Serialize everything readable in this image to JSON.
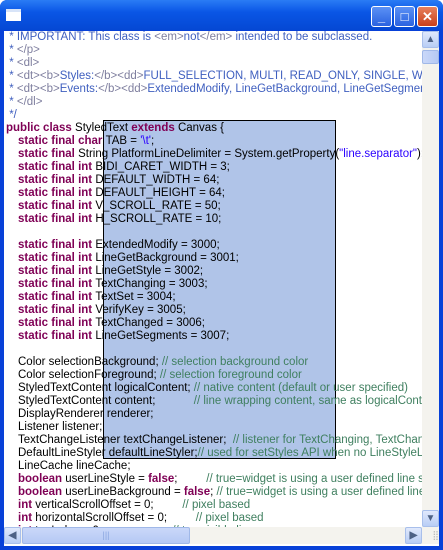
{
  "window": {
    "icon": "window-icon",
    "minimize": "_",
    "maximize": "□",
    "close": "✕"
  },
  "colors": {
    "keyword": "#7f0055",
    "comment": "#3f7f5f",
    "javadoc": "#3f5fbf",
    "string": "#2a00ff",
    "overlay": "#b0c4e8"
  },
  "scrollbars": {
    "up": "▲",
    "down": "▼",
    "left": "◀",
    "right": "▶",
    "grip": "⣿"
  },
  "lines": [
    {
      "i": 0,
      "s": [
        [
          "jd",
          " * IMPORTANT: This class is "
        ],
        [
          "tg",
          "<em>"
        ],
        [
          "jd",
          "not"
        ],
        [
          "tg",
          "</em>"
        ],
        [
          "jd",
          " intended to be subclassed."
        ]
      ]
    },
    {
      "i": 0,
      "s": [
        [
          "jd",
          " * "
        ],
        [
          "tg",
          "</p>"
        ]
      ]
    },
    {
      "i": 0,
      "s": [
        [
          "jd",
          " * "
        ],
        [
          "tg",
          "<dl>"
        ]
      ]
    },
    {
      "i": 0,
      "s": [
        [
          "jd",
          " * "
        ],
        [
          "tg",
          "<dt><b>"
        ],
        [
          "jd",
          "Styles:"
        ],
        [
          "tg",
          "</b><dd>"
        ],
        [
          "jd",
          "FULL_SELECTION, MULTI, READ_ONLY, SINGLE, WRAP"
        ]
      ]
    },
    {
      "i": 0,
      "s": [
        [
          "jd",
          " * "
        ],
        [
          "tg",
          "<dt><b>"
        ],
        [
          "jd",
          "Events:"
        ],
        [
          "tg",
          "</b><dd>"
        ],
        [
          "jd",
          "ExtendedModify, LineGetBackground, LineGetSegments"
        ]
      ]
    },
    {
      "i": 0,
      "s": [
        [
          "jd",
          " * "
        ],
        [
          "tg",
          "</dl>"
        ]
      ]
    },
    {
      "i": 0,
      "s": [
        [
          "jd",
          " */"
        ]
      ]
    },
    {
      "i": 0,
      "s": [
        [
          "kw",
          "public class "
        ],
        [
          "pl",
          "StyledText "
        ],
        [
          "kw",
          "extends "
        ],
        [
          "pl",
          "Canvas {"
        ]
      ]
    },
    {
      "i": 1,
      "s": [
        [
          "kw",
          "static final char "
        ],
        [
          "pl",
          "TAB = "
        ],
        [
          "st",
          "'\\t'"
        ],
        [
          "pl",
          ";"
        ]
      ]
    },
    {
      "i": 1,
      "s": [
        [
          "kw",
          "static final "
        ],
        [
          "pl",
          "String PlatformLineDelimiter = System.getProperty("
        ],
        [
          "st",
          "\"line.separator\""
        ],
        [
          "pl",
          ");"
        ]
      ]
    },
    {
      "i": 1,
      "s": [
        [
          "kw",
          "static final int "
        ],
        [
          "pl",
          "BIDI_CARET_WIDTH = 3;"
        ]
      ]
    },
    {
      "i": 1,
      "s": [
        [
          "kw",
          "static final int "
        ],
        [
          "pl",
          "DEFAULT_WIDTH = 64;"
        ]
      ]
    },
    {
      "i": 1,
      "s": [
        [
          "kw",
          "static final int "
        ],
        [
          "pl",
          "DEFAULT_HEIGHT = 64;"
        ]
      ]
    },
    {
      "i": 1,
      "s": [
        [
          "kw",
          "static final int "
        ],
        [
          "pl",
          "V_SCROLL_RATE = 50;"
        ]
      ]
    },
    {
      "i": 1,
      "s": [
        [
          "kw",
          "static final int "
        ],
        [
          "pl",
          "H_SCROLL_RATE = 10;"
        ]
      ]
    },
    {
      "i": 1,
      "s": []
    },
    {
      "i": 1,
      "s": [
        [
          "kw",
          "static final int "
        ],
        [
          "pl",
          "ExtendedModify = 3000;"
        ]
      ]
    },
    {
      "i": 1,
      "s": [
        [
          "kw",
          "static final int "
        ],
        [
          "pl",
          "LineGetBackground = 3001;"
        ]
      ]
    },
    {
      "i": 1,
      "s": [
        [
          "kw",
          "static final int "
        ],
        [
          "pl",
          "LineGetStyle = 3002;"
        ]
      ]
    },
    {
      "i": 1,
      "s": [
        [
          "kw",
          "static final int "
        ],
        [
          "pl",
          "TextChanging = 3003;"
        ]
      ]
    },
    {
      "i": 1,
      "s": [
        [
          "kw",
          "static final int "
        ],
        [
          "pl",
          "TextSet = 3004;"
        ]
      ]
    },
    {
      "i": 1,
      "s": [
        [
          "kw",
          "static final int "
        ],
        [
          "pl",
          "VerifyKey = 3005;"
        ]
      ]
    },
    {
      "i": 1,
      "s": [
        [
          "kw",
          "static final int "
        ],
        [
          "pl",
          "TextChanged = 3006;"
        ]
      ]
    },
    {
      "i": 1,
      "s": [
        [
          "kw",
          "static final int "
        ],
        [
          "pl",
          "LineGetSegments = 3007;"
        ]
      ]
    },
    {
      "i": 1,
      "s": []
    },
    {
      "i": 1,
      "s": [
        [
          "pl",
          "Color selectionBackground; "
        ],
        [
          "cm",
          "// selection background color"
        ]
      ]
    },
    {
      "i": 1,
      "s": [
        [
          "pl",
          "Color selectionForeground; "
        ],
        [
          "cm",
          "// selection foreground color"
        ]
      ]
    },
    {
      "i": 1,
      "s": [
        [
          "pl",
          "StyledTextContent logicalContent; "
        ],
        [
          "cm",
          "// native content (default or user specified)"
        ]
      ]
    },
    {
      "i": 1,
      "s": [
        [
          "pl",
          "StyledTextContent content;            "
        ],
        [
          "cm",
          "// line wrapping content, same as logicalContent if no wrapping"
        ]
      ]
    },
    {
      "i": 1,
      "s": [
        [
          "pl",
          "DisplayRenderer renderer;"
        ]
      ]
    },
    {
      "i": 1,
      "s": [
        [
          "pl",
          "Listener listener;"
        ]
      ]
    },
    {
      "i": 1,
      "s": [
        [
          "pl",
          "TextChangeListener textChangeListener;  "
        ],
        [
          "cm",
          "// listener for TextChanging, TextChanged and TextSet"
        ]
      ]
    },
    {
      "i": 1,
      "s": [
        [
          "pl",
          "DefaultLineStyler defaultLineStyler;"
        ],
        [
          "cm",
          "// used for setStyles API when no LineStyleListener is registered"
        ]
      ]
    },
    {
      "i": 1,
      "s": [
        [
          "pl",
          "LineCache lineCache;"
        ]
      ]
    },
    {
      "i": 1,
      "s": [
        [
          "kw",
          "boolean "
        ],
        [
          "pl",
          "userLineStyle = "
        ],
        [
          "kw",
          "false"
        ],
        [
          "pl",
          ";         "
        ],
        [
          "cm",
          "// true=widget is using a user defined line style listener"
        ]
      ]
    },
    {
      "i": 1,
      "s": [
        [
          "kw",
          "boolean "
        ],
        [
          "pl",
          "userLineBackground = "
        ],
        [
          "kw",
          "false"
        ],
        [
          "pl",
          "; "
        ],
        [
          "cm",
          "// true=widget is using a user defined line background listener"
        ]
      ]
    },
    {
      "i": 1,
      "s": [
        [
          "kw",
          "int "
        ],
        [
          "pl",
          "verticalScrollOffset = 0;         "
        ],
        [
          "cm",
          "// pixel based"
        ]
      ]
    },
    {
      "i": 1,
      "s": [
        [
          "kw",
          "int "
        ],
        [
          "pl",
          "horizontalScrollOffset = 0;         "
        ],
        [
          "cm",
          "// pixel based"
        ]
      ]
    },
    {
      "i": 1,
      "s": [
        [
          "kw",
          "int "
        ],
        [
          "pl",
          "topIndex = 0;                      "
        ],
        [
          "cm",
          "// top visible line"
        ]
      ]
    }
  ]
}
